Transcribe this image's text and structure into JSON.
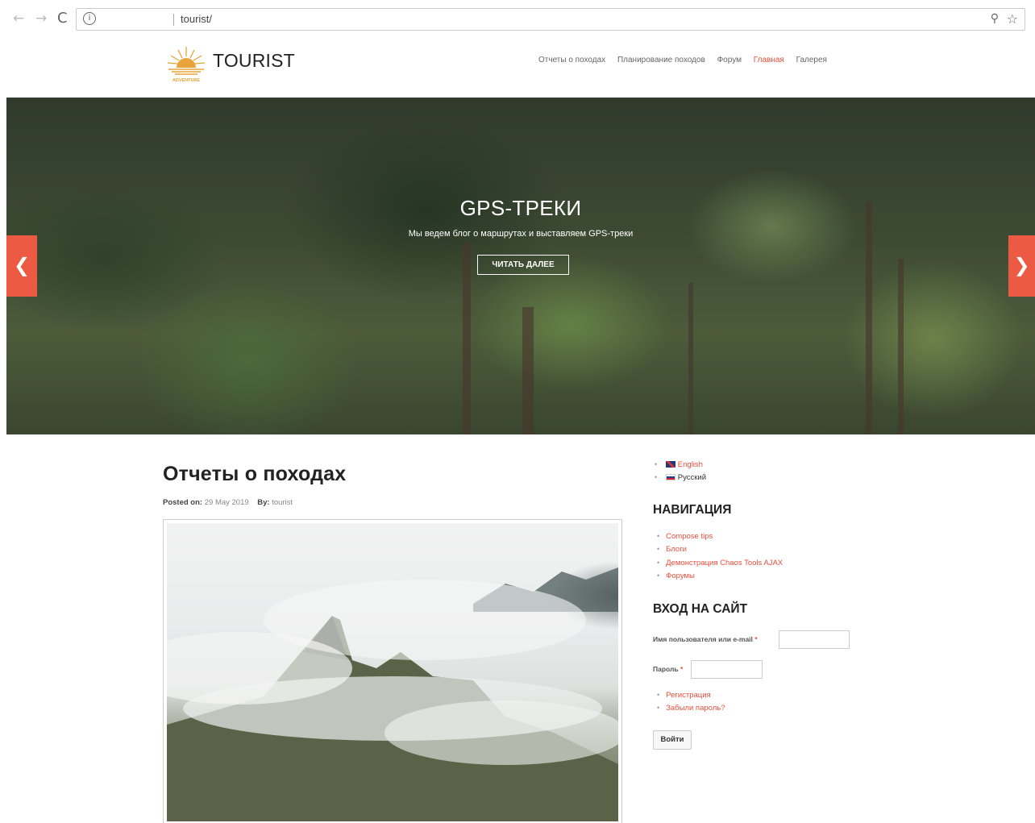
{
  "browser": {
    "back_icon": "arrow-left-icon",
    "forward_icon": "arrow-right-icon",
    "reload_icon": "reload-icon",
    "info_icon": "info-icon",
    "url": "tourist/",
    "zoom_icon": "zoom-icon",
    "bookmark_icon": "star-icon",
    "glyphs": {
      "back": "←",
      "forward": "→",
      "reload": "C",
      "info": "i",
      "zoom": "⚲",
      "star": "☆"
    }
  },
  "header": {
    "brand": "TOURIST",
    "logo_text": "ADVENTURE",
    "nav": [
      {
        "label": "Отчеты о походах",
        "active": false
      },
      {
        "label": "Планирование походов",
        "active": false
      },
      {
        "label": "Форум",
        "active": false
      },
      {
        "label": "Главная",
        "active": true
      },
      {
        "label": "Галерея",
        "active": false
      }
    ],
    "accent_color": "#e94e3b"
  },
  "hero": {
    "title": "GPS-ТРЕКИ",
    "subtitle": "Мы ведем блог о маршрутах и выставляем GPS-треки",
    "button": "ЧИТАТЬ ДАЛЕЕ",
    "prev_glyph": "❮",
    "next_glyph": "❯"
  },
  "post": {
    "title": "Отчеты о походах",
    "posted_label": "Posted on:",
    "posted_date": "29 May 2019",
    "by_label": "By:",
    "author": "tourist"
  },
  "sidebar": {
    "languages": [
      {
        "label": "English",
        "flag": "uk-flag-icon"
      },
      {
        "label": "Русский",
        "flag": "ru-flag-icon"
      }
    ],
    "nav_title": "НАВИГАЦИЯ",
    "nav_items": [
      "Compose tips",
      "Блоги",
      "Демонстрация Chaos Tools AJAX",
      "Форумы"
    ],
    "login_title": "ВХОД НА САЙТ",
    "username_label": "Имя пользователя или e-mail",
    "password_label": "Пароль",
    "required_mark": "*",
    "login_links": [
      "Регистрация",
      "Забыли пароль?"
    ],
    "login_button": "Войти"
  }
}
